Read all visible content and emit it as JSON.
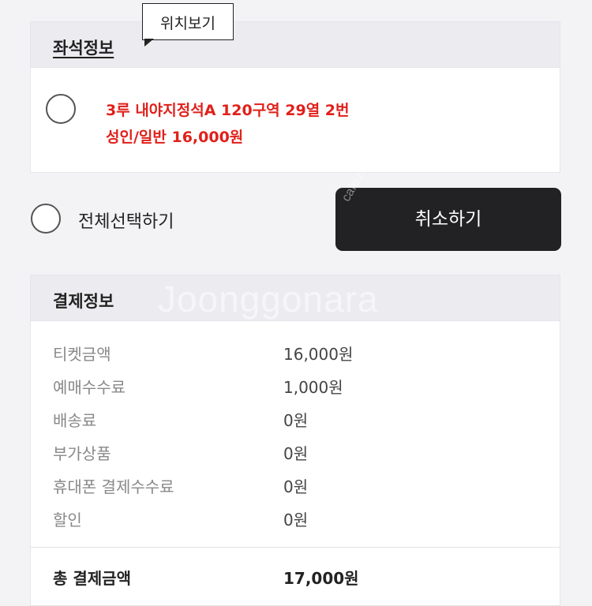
{
  "tooltip": {
    "label": "위치보기"
  },
  "seat_info": {
    "title": "좌석정보",
    "seat": "3루 내야지정석A 120구역 29열 2번",
    "price_line": "성인/일반 16,000원"
  },
  "select_all": {
    "label": "전체선택하기"
  },
  "cancel_button": {
    "label": "취소하기"
  },
  "payment_info": {
    "title": "결제정보",
    "rows": [
      {
        "label": "티켓금액",
        "value": "16,000원"
      },
      {
        "label": "예매수수료",
        "value": "1,000원"
      },
      {
        "label": "배송료",
        "value": "0원"
      },
      {
        "label": "부가상품",
        "value": "0원"
      },
      {
        "label": "휴대폰 결제수수료",
        "value": "0원"
      },
      {
        "label": "할인",
        "value": "0원"
      }
    ],
    "total_label": "총 결제금액",
    "total_value": "17,000원"
  },
  "watermark": {
    "text": "Joonggonara",
    "side_text": "cafe.naver.com"
  }
}
